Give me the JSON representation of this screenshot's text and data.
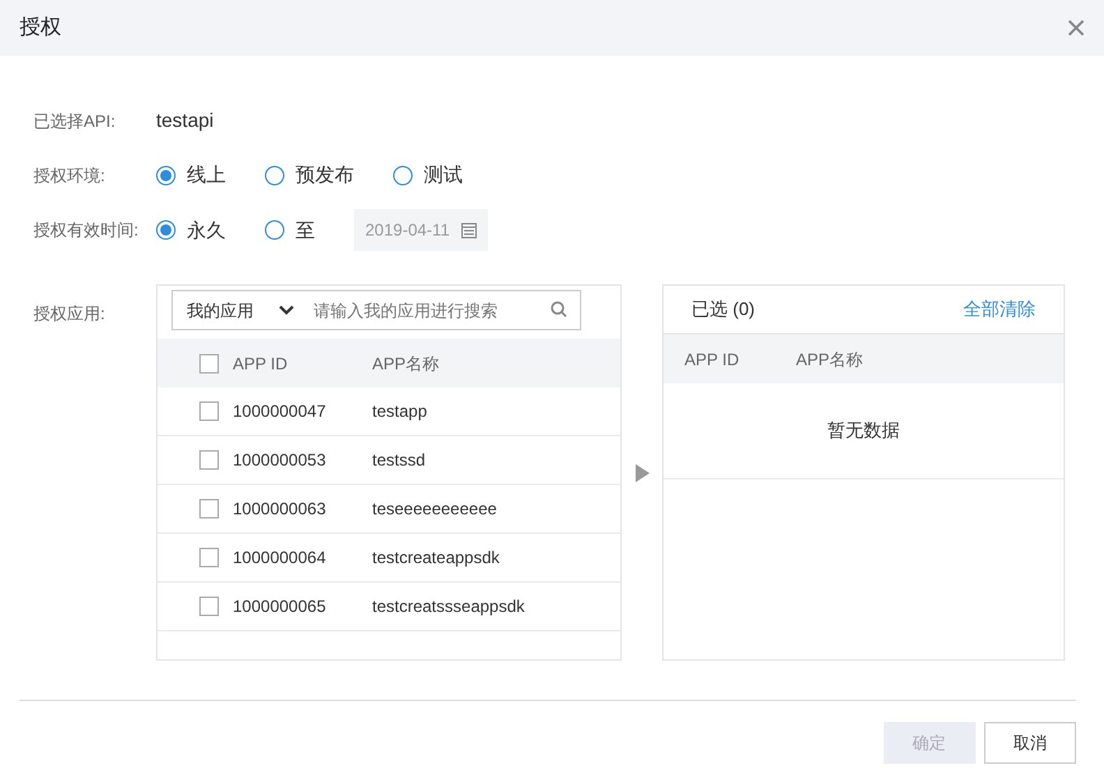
{
  "window": {
    "title": "授权"
  },
  "api": {
    "label": "已选择API:",
    "value": "testapi"
  },
  "environment": {
    "label": "授权环境:",
    "options": [
      {
        "label": "线上",
        "selected": true
      },
      {
        "label": "预发布",
        "selected": false
      },
      {
        "label": "测试",
        "selected": false
      }
    ]
  },
  "validity": {
    "label": "授权有效时间:",
    "options": [
      {
        "label": "永久",
        "selected": true
      },
      {
        "label": "至",
        "selected": false
      }
    ],
    "date": "2019-04-11"
  },
  "apps": {
    "label": "授权应用:",
    "dropdown": "我的应用",
    "search": {
      "placeholder": "请输入我的应用进行搜索"
    },
    "columns": [
      "APP ID",
      "APP名称"
    ],
    "all_checked": false,
    "rows": [
      {
        "id": "1000000047",
        "name": "testapp",
        "checked": false
      },
      {
        "id": "1000000053",
        "name": "testssd",
        "checked": false
      },
      {
        "id": "1000000063",
        "name": "teseeeeeeeeeee",
        "checked": false
      },
      {
        "id": "1000000064",
        "name": "testcreateappsdk",
        "checked": false
      },
      {
        "id": "1000000065",
        "name": "testcreatssseappsdk",
        "checked": false
      }
    ]
  },
  "selected_panel": {
    "title": "已选 (0)",
    "clear": "全部清除",
    "columns": [
      "APP ID",
      "APP名称"
    ],
    "empty": "暂无数据"
  },
  "buttons": [
    {
      "label": "确定",
      "disabled": true
    },
    {
      "label": "取消",
      "disabled": false
    }
  ]
}
